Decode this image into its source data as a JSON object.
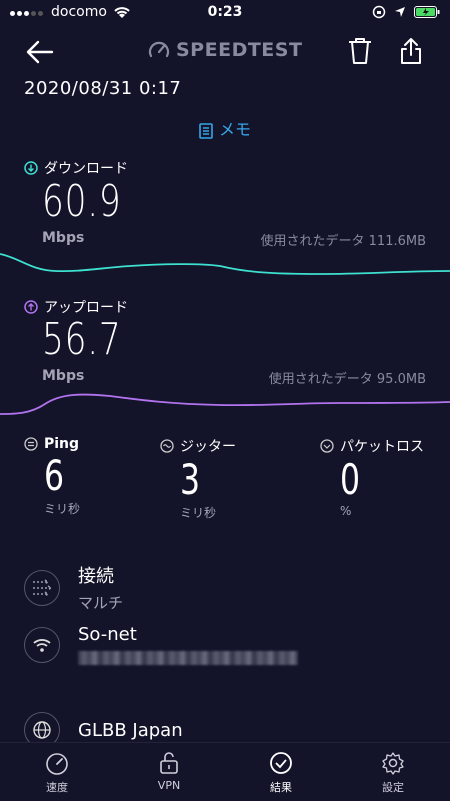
{
  "status": {
    "carrier": "docomo",
    "time": "0:23"
  },
  "header": {
    "logo_text": "SPEEDTEST"
  },
  "result": {
    "date": "2020/08/31 0:17",
    "memo_label": "メモ"
  },
  "download": {
    "title": "ダウンロード",
    "value": "60.9",
    "unit": "Mbps",
    "data_used": "使用されたデータ 111.6MB",
    "color": "#3ee0d0"
  },
  "upload": {
    "title": "アップロード",
    "value": "56.7",
    "unit": "Mbps",
    "data_used": "使用されたデータ 95.0MB",
    "color": "#b274ee"
  },
  "stats": [
    {
      "title": "Ping",
      "value": "6",
      "unit": "ミリ秒"
    },
    {
      "title": "ジッター",
      "value": "3",
      "unit": "ミリ秒"
    },
    {
      "title": "パケットロス",
      "value": "0",
      "unit": "%"
    }
  ],
  "connection": {
    "title": "接続",
    "subtitle": "マルチ"
  },
  "provider": {
    "title": "So-net"
  },
  "server": {
    "title": "GLBB Japan"
  },
  "tabs": [
    {
      "label": "速度",
      "icon": "speed-gauge-icon"
    },
    {
      "label": "VPN",
      "icon": "lock-icon"
    },
    {
      "label": "結果",
      "icon": "check-circle-icon"
    },
    {
      "label": "設定",
      "icon": "gear-icon"
    }
  ]
}
